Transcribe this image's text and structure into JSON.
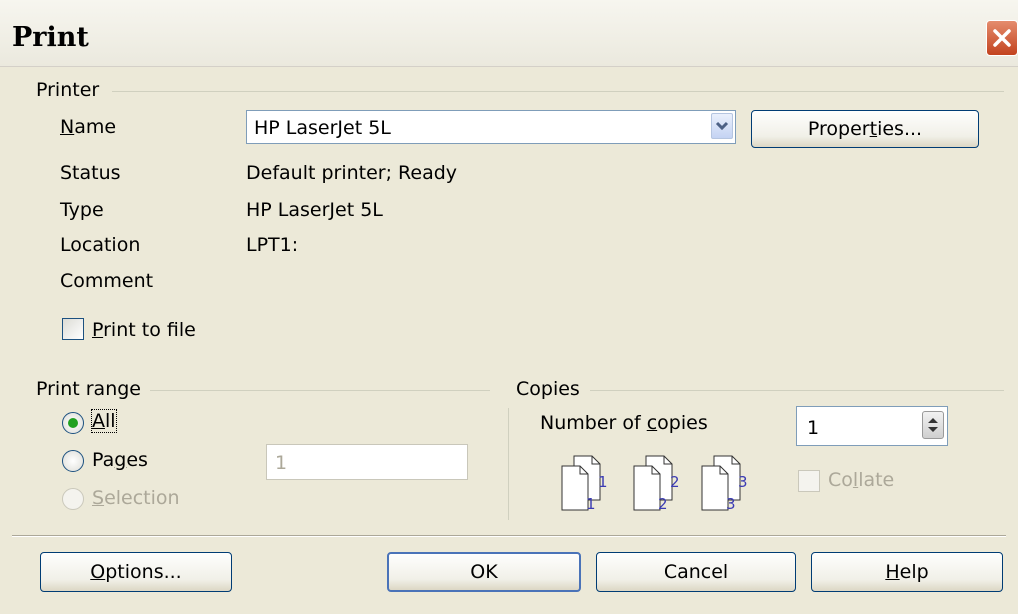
{
  "window": {
    "title": "Print",
    "close_icon": "close-icon"
  },
  "printer": {
    "group_label": "Printer",
    "name_label_pre": "",
    "name_label_ul": "N",
    "name_label_post": "ame",
    "name_value": "HP LaserJet 5L",
    "properties_pre": "Proper",
    "properties_ul": "t",
    "properties_post": "ies...",
    "status_label": "Status",
    "status_value": "Default printer; Ready",
    "type_label": "Type",
    "type_value": "HP LaserJet 5L",
    "location_label": "Location",
    "location_value": "LPT1:",
    "comment_label": "Comment",
    "print_to_file_ul": "P",
    "print_to_file_post": "rint to file",
    "print_to_file_checked": false
  },
  "print_range": {
    "group_label": "Print range",
    "all_ul": "A",
    "all_post": "ll",
    "pages_pre": "Pa",
    "pages_ul": "g",
    "pages_post": "es",
    "pages_value": "1",
    "selection_ul": "S",
    "selection_post": "election",
    "selected": "All"
  },
  "copies": {
    "group_label": "Copies",
    "number_pre": "Number of ",
    "number_ul": "c",
    "number_post": "opies",
    "value": "1",
    "collate_pre": "Co",
    "collate_ul": "l",
    "collate_post": "late",
    "collate_checked": false,
    "page_numbers": [
      "1",
      "1",
      "2",
      "2",
      "3",
      "3"
    ]
  },
  "buttons": {
    "options_ul": "O",
    "options_post": "ptions...",
    "ok": "OK",
    "cancel": "Cancel",
    "help_ul": "H",
    "help_post": "elp"
  },
  "colors": {
    "accent": "#4a73b8",
    "radio_dot": "#21a121",
    "page_number": "#3b3bb3"
  }
}
